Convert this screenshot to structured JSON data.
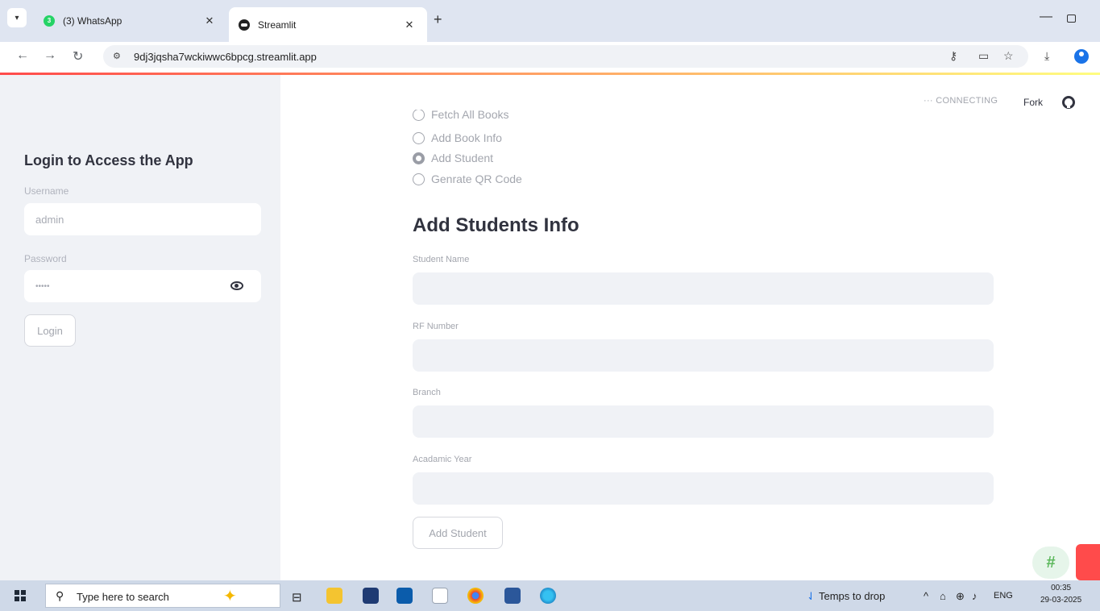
{
  "browser": {
    "tabs": [
      {
        "title": "(3) WhatsApp",
        "badge": "3"
      },
      {
        "title": "Streamlit"
      }
    ],
    "url": "9dj3jqsha7wckiwwc6bpcg.streamlit.app"
  },
  "sidebar": {
    "title": "Login to Access the App",
    "username_label": "Username",
    "username_value": "admin",
    "password_label": "Password",
    "password_value": "•••••",
    "login_button": "Login"
  },
  "header": {
    "status": "CONNECTING",
    "fork": "Fork"
  },
  "menu": {
    "options": [
      {
        "label": "Fetch All Books",
        "checked": false
      },
      {
        "label": "Add Book Info",
        "checked": false
      },
      {
        "label": "Add Student",
        "checked": true
      },
      {
        "label": "Genrate QR Code",
        "checked": false
      }
    ]
  },
  "form": {
    "title": "Add Students Info",
    "fields": [
      {
        "label": "Student Name",
        "value": ""
      },
      {
        "label": "RF Number",
        "value": ""
      },
      {
        "label": "Branch",
        "value": ""
      },
      {
        "label": "Acadamic Year",
        "value": ""
      }
    ],
    "submit": "Add Student"
  },
  "taskbar": {
    "search_placeholder": "Type here to search",
    "weather": "Temps to drop",
    "language": "ENG",
    "time": "00:35",
    "date": "29-03-2025"
  }
}
